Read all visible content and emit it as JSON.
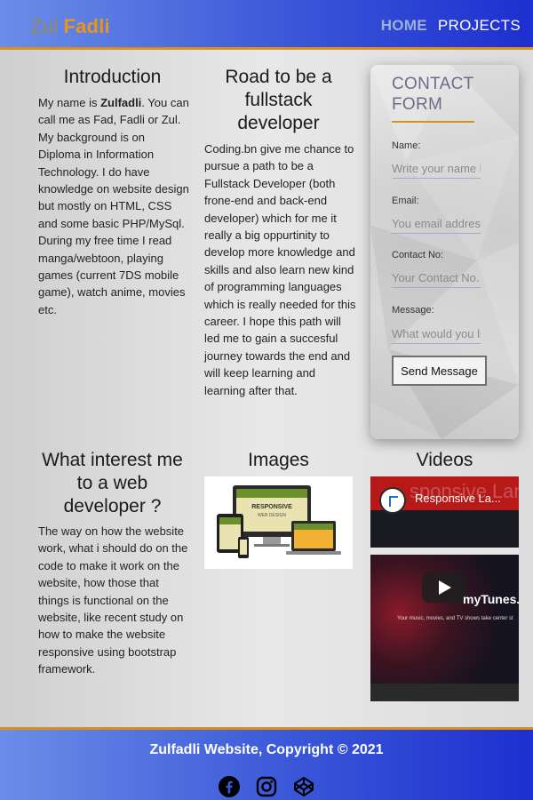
{
  "header": {
    "brand_first": "Zul",
    "brand_last": "Fadli",
    "nav": [
      {
        "label": "HOME"
      },
      {
        "label": "PROJECTS"
      }
    ]
  },
  "intro": {
    "title": "Introduction",
    "prefix": "My name is ",
    "name_bold": "Zulfadli",
    "text": ". You can call me as Fad, Fadli or Zul. My background is on Diploma in Information Technology. I do have knowledge on website design but mostly on HTML, CSS and some basic PHP/MySql. During my free time I read manga/webtoon, playing games (current 7DS mobile game), watch anime, movies etc."
  },
  "road": {
    "title": "Road to be a fullstack developer",
    "text": "Coding.bn give me chance to pursue a path to be a Fullstack Developer (both frone-end and back-end developer) which for me it really a big oppurtinity to develop more knowledge and skills and also learn new kind of programming languages which is really needed for this career. I hope this path will led me to gain a succesful journey towards the end and will keep learning and learning after that."
  },
  "contact": {
    "title": "CONTACT FORM",
    "fields": [
      {
        "label": "Name:",
        "placeholder": "Write your name here"
      },
      {
        "label": "Email:",
        "placeholder": "You email address"
      },
      {
        "label": "Contact No:",
        "placeholder": "Your Contact No."
      },
      {
        "label": "Message:",
        "placeholder": "What would you like to say"
      }
    ],
    "submit_label": "Send Message"
  },
  "interest": {
    "title": "What interest me to a web developer ?",
    "text": "The way on how the website work, what i should do on the code to make it work on the website, how those that things is functional on the website, like recent study on how to make the website responsive using bootstrap framework."
  },
  "images": {
    "title": "Images",
    "badge_line1": "RESPONSIVE",
    "badge_line2": "WEB DESIGN"
  },
  "videos": {
    "title": "Videos",
    "video_title": "Responsive La...",
    "bg_text": "sponsive Landi",
    "brand": "myTunes.",
    "caption": "Your music, movies, and TV shows take center st"
  },
  "footer": {
    "text": "Zulfadli Website, Copyright © 2021",
    "icons": [
      "facebook-icon",
      "instagram-icon",
      "codepen-icon"
    ]
  },
  "colors": {
    "accent": "#d9901a",
    "brand_orange": "#e8951a",
    "header_blue": "#3a57d8",
    "contact_title": "#6b6d88"
  }
}
